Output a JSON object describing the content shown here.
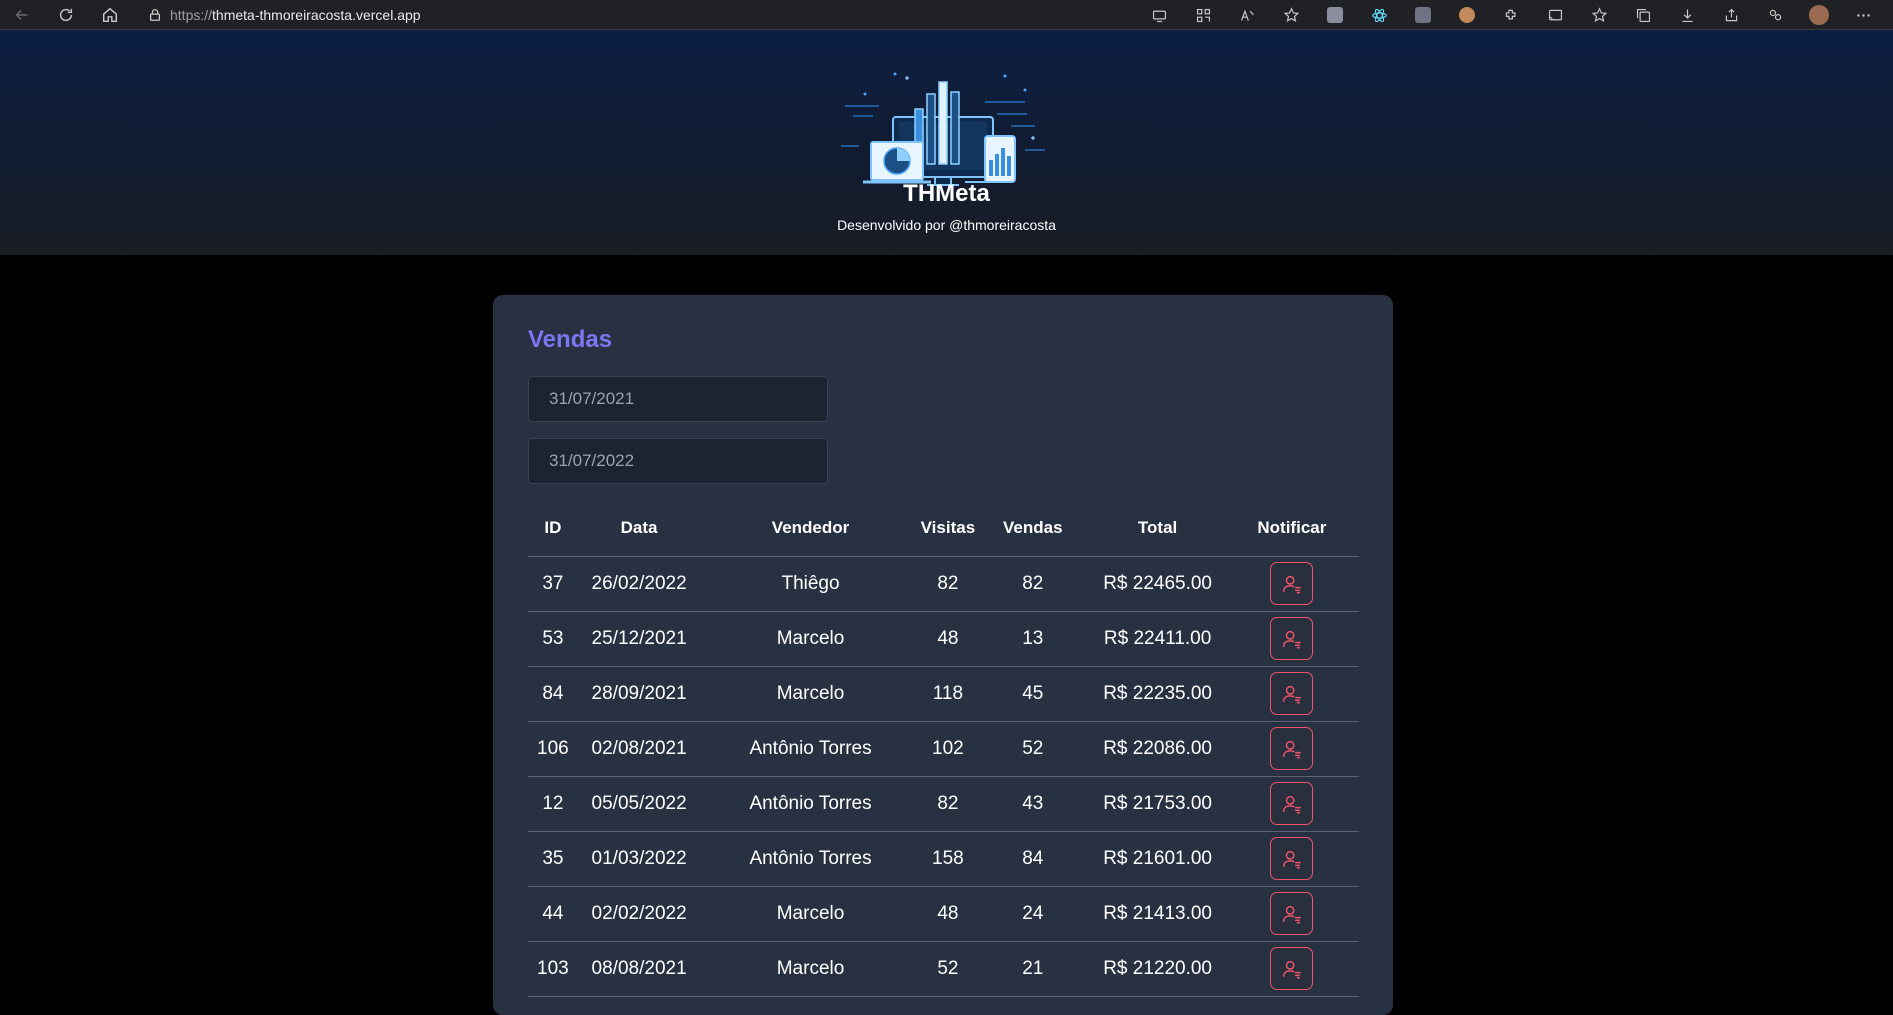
{
  "browser": {
    "url_protocol": "https://",
    "url_host": "thmeta-thmoreiracosta.vercel.app"
  },
  "header": {
    "title": "THMeta",
    "subtitle": "Desenvolvido por @thmoreiracosta"
  },
  "sales": {
    "title": "Vendas",
    "min_date": "31/07/2021",
    "max_date": "31/07/2022",
    "columns": [
      "ID",
      "Data",
      "Vendedor",
      "Visitas",
      "Vendas",
      "Total",
      "Notificar"
    ],
    "rows": [
      {
        "id": "37",
        "date": "26/02/2022",
        "seller": "Thiêgo",
        "visits": "82",
        "sales": "82",
        "total": "R$ 22465.00"
      },
      {
        "id": "53",
        "date": "25/12/2021",
        "seller": "Marcelo",
        "visits": "48",
        "sales": "13",
        "total": "R$ 22411.00"
      },
      {
        "id": "84",
        "date": "28/09/2021",
        "seller": "Marcelo",
        "visits": "118",
        "sales": "45",
        "total": "R$ 22235.00"
      },
      {
        "id": "106",
        "date": "02/08/2021",
        "seller": "Antônio Torres",
        "visits": "102",
        "sales": "52",
        "total": "R$ 22086.00"
      },
      {
        "id": "12",
        "date": "05/05/2022",
        "seller": "Antônio Torres",
        "visits": "82",
        "sales": "43",
        "total": "R$ 21753.00"
      },
      {
        "id": "35",
        "date": "01/03/2022",
        "seller": "Antônio Torres",
        "visits": "158",
        "sales": "84",
        "total": "R$ 21601.00"
      },
      {
        "id": "44",
        "date": "02/02/2022",
        "seller": "Marcelo",
        "visits": "48",
        "sales": "24",
        "total": "R$ 21413.00"
      },
      {
        "id": "103",
        "date": "08/08/2021",
        "seller": "Marcelo",
        "visits": "52",
        "sales": "21",
        "total": "R$ 21220.00"
      }
    ]
  },
  "colors": {
    "accent": "#7d76f2",
    "notify": "#f0546a",
    "card": "#283142"
  }
}
